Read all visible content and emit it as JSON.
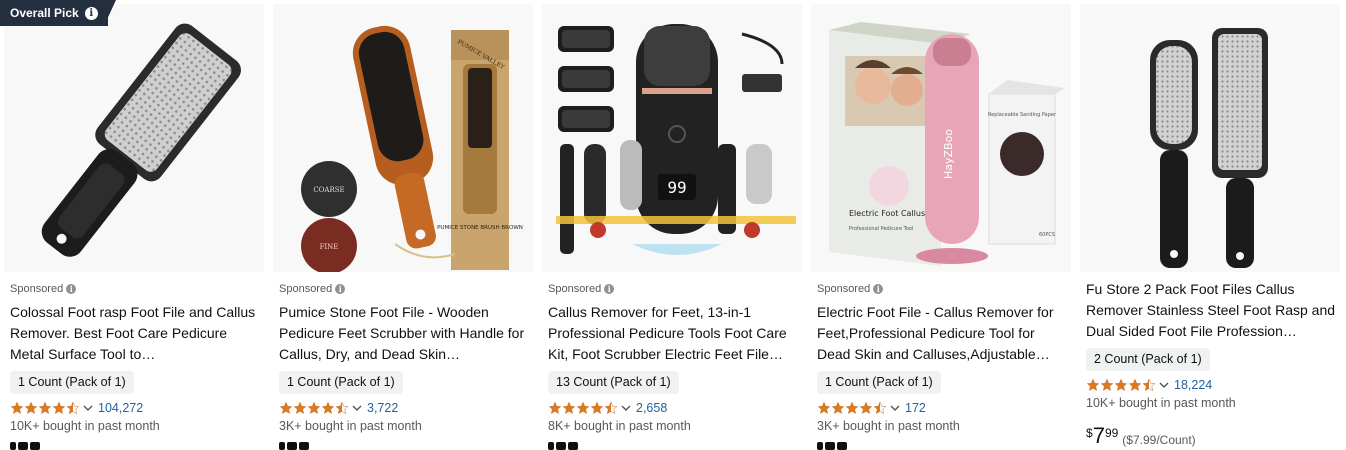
{
  "badge": {
    "label": "Overall Pick",
    "icon": "info-icon"
  },
  "sponsored_label": "Sponsored",
  "products": [
    {
      "title": "Colossal Foot rasp Foot File and Callus Remover. Best Foot Care Pedicure Metal Surface Tool to…",
      "sponsored": true,
      "count": "1 Count (Pack of 1)",
      "rating": 4.5,
      "reviews": "104,272",
      "bought": "10K+ bought in past month"
    },
    {
      "title": "Pumice Stone Foot File - Wooden Pedicure Feet Scrubber with Handle for Callus, Dry, and Dead Skin…",
      "sponsored": true,
      "count": "1 Count (Pack of 1)",
      "rating": 4.5,
      "reviews": "3,722",
      "bought": "3K+ bought in past month",
      "image_text": {
        "brand": "PUMICE VALLEY",
        "coarse": "COARSE",
        "fine": "FINE",
        "box_label": "PUMICE STONE BRUSH BROWN"
      }
    },
    {
      "title": "Callus Remover for Feet, 13-in-1 Professional Pedicure Tools Foot Care Kit, Foot Scrubber Electric Feet File…",
      "sponsored": true,
      "count": "13 Count (Pack of 1)",
      "rating": 4.5,
      "reviews": "2,658",
      "bought": "8K+ bought in past month",
      "image_text": {
        "display": "99"
      }
    },
    {
      "title": "Electric Foot File - Callus Remover for Feet,Professional Pedicure Tool for Dead Skin and Calluses,Adjustable…",
      "sponsored": true,
      "count": "1 Count (Pack of 1)",
      "rating": 4.5,
      "reviews": "172",
      "bought": "3K+ bought in past month",
      "image_text": {
        "brand": "HayZBoo",
        "box_title": "Electric Foot Callus Remover",
        "box_sub": "Professional Pedicure Tool",
        "paper_title": "Replaceable Sanding Paper",
        "paper_count": "60PCS"
      }
    },
    {
      "title": "Fu Store 2 Pack Foot Files Callus Remover Stainless Steel Foot Rasp and Dual Sided Foot File Profession…",
      "sponsored": false,
      "count": "2 Count (Pack of 1)",
      "rating": 4.5,
      "reviews": "18,224",
      "bought": "10K+ bought in past month",
      "price": {
        "symbol": "$",
        "whole": "7",
        "fraction": "99",
        "unit": "($7.99/Count)"
      }
    }
  ],
  "colors": {
    "star": "#de7921",
    "link": "#2162a1",
    "badge_bg": "#232f3e",
    "pill_bg": "#f0f2f2",
    "muted": "#565959"
  }
}
